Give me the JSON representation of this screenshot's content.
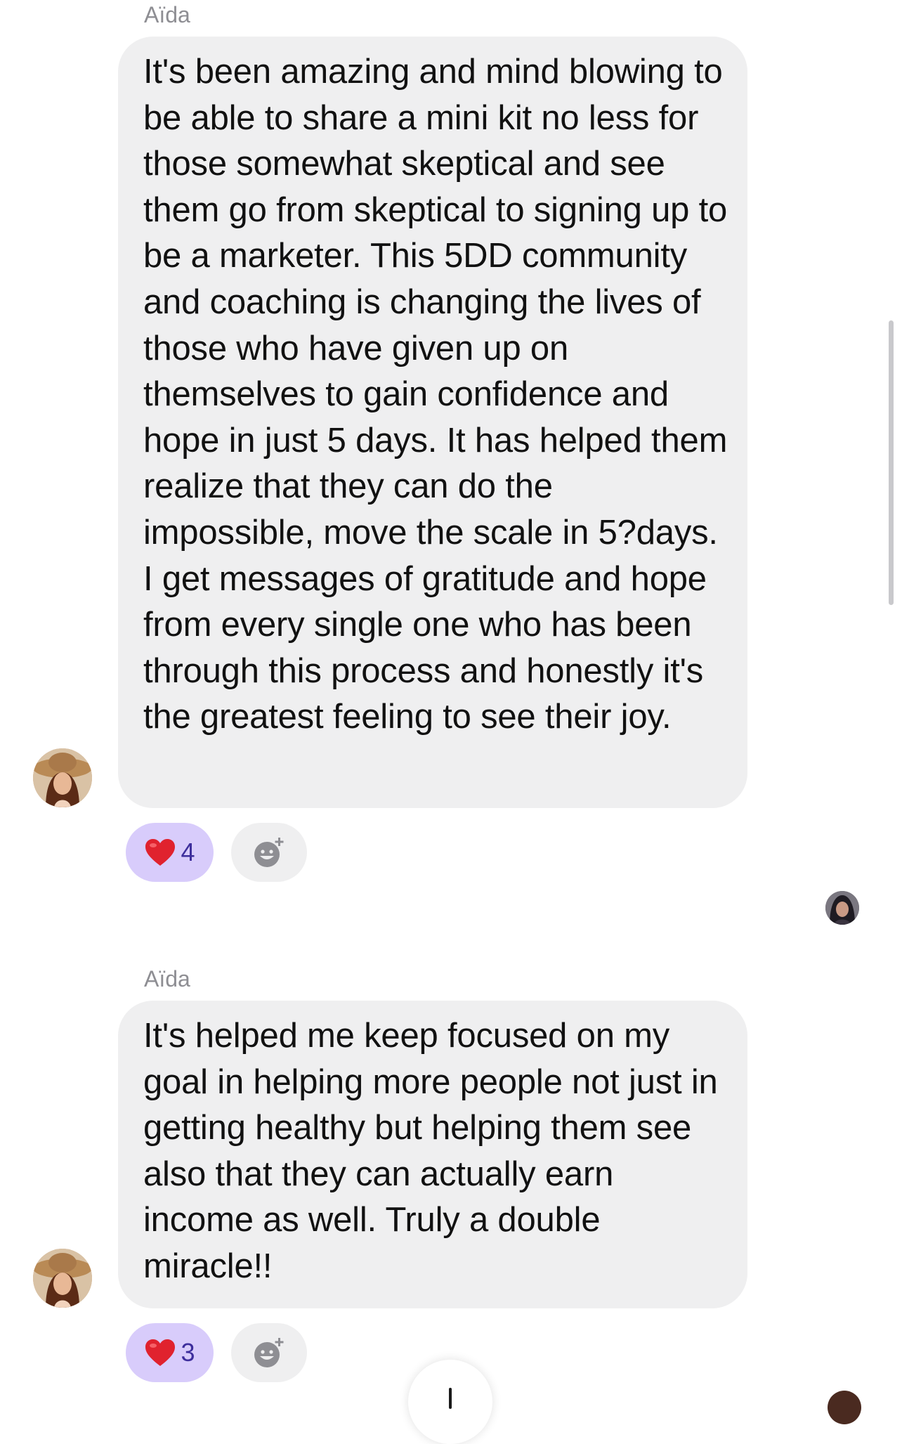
{
  "messages": [
    {
      "sender": "Aïda",
      "text": "It's been amazing and mind blowing to be able to share a mini kit no less for those somewhat skeptical and see them go from skeptical to signing up to be a marketer. This 5DD community and coaching is changing the lives of those who have given up on themselves to gain confidence and hope in just 5 days. It has helped them realize that they can do the impossible, move the scale in 5?days. I get messages of gratitude and hope from every single one who has been through this process and honestly it's the greatest feeling to see their joy.",
      "reaction": {
        "emoji": "heart-icon",
        "count": "4"
      }
    },
    {
      "sender": "Aïda",
      "text": "It's helped me keep focused on my goal in helping more people not just in getting healthy but helping them see also that they can actually earn income as well. Truly a double miracle!!",
      "reaction": {
        "emoji": "heart-icon",
        "count": "3"
      }
    }
  ],
  "colors": {
    "bubble": "#efeff0",
    "reaction_pill": "#d8ccfb",
    "reaction_count": "#3d2e9c",
    "sender_name": "#8e8e93",
    "heart": "#e0222e"
  }
}
